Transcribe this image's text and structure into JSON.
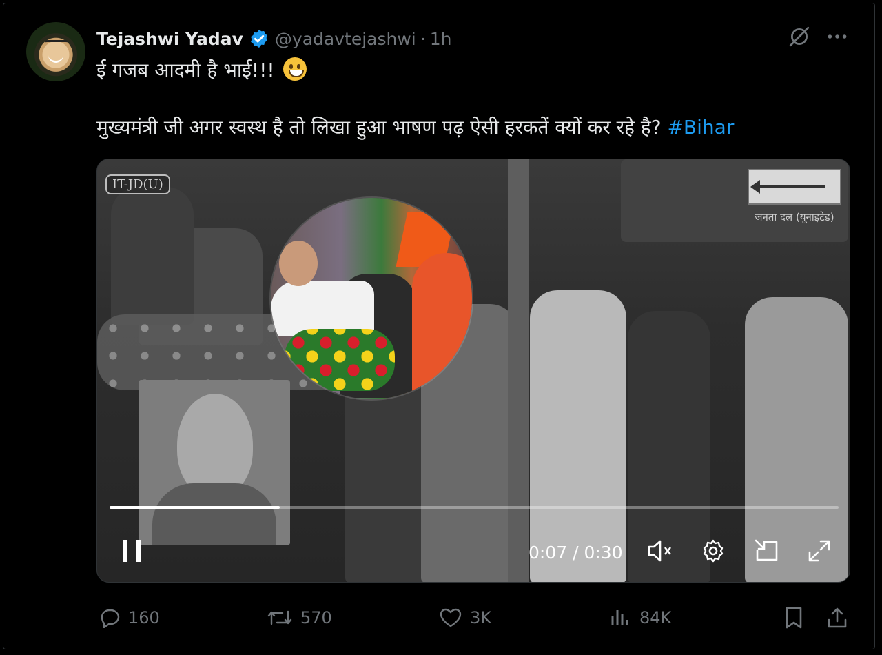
{
  "tweet": {
    "author_name": "Tejashwi Yadav",
    "handle": "@yadavtejashwi",
    "separator": "·",
    "time": "1h",
    "line1": "ई गजब आदमी है भाई!!!",
    "line2": "मुख्यमंत्री जी अगर स्वस्थ है तो लिखा हुआ भाषण पढ़ ऐसी हरकतें क्यों कर रहे है?",
    "hashtag": "#Bihar",
    "verified": true
  },
  "video": {
    "watermark_left": "IT-JD(U)",
    "logo_caption": "जनता दल (यूनाइटेड)",
    "time_display": "0:07 / 0:30",
    "progress_fraction": 0.2333,
    "playing": true,
    "muted": true
  },
  "actions": {
    "replies": "160",
    "reposts": "570",
    "likes": "3K",
    "views": "84K"
  },
  "colors": {
    "accent": "#1d9bf0",
    "muted_text": "#71767b",
    "text": "#e7e9ea",
    "background": "#000000"
  },
  "icons": [
    "grok-icon",
    "more-icon",
    "verified-badge-icon",
    "pause-icon",
    "volume-muted-icon",
    "settings-icon",
    "exit-dock-icon",
    "fullscreen-icon",
    "reply-icon",
    "repost-icon",
    "like-icon",
    "views-icon",
    "bookmark-icon",
    "share-icon"
  ]
}
